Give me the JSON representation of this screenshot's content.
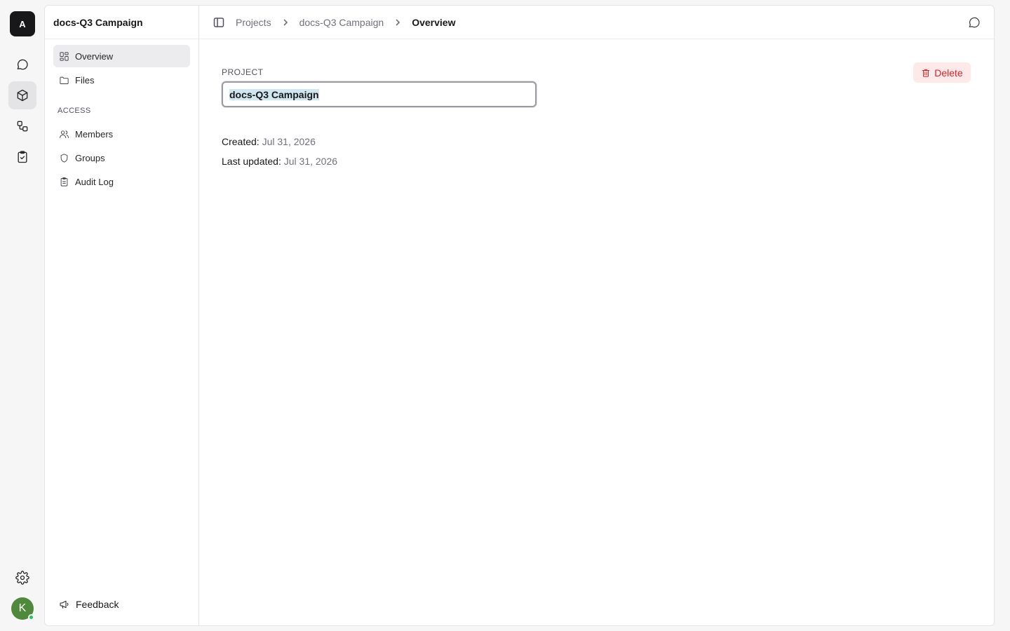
{
  "rail": {
    "logo_letter": "A",
    "avatar_letter": "K",
    "items": [
      {
        "icon": "chat-icon"
      },
      {
        "icon": "box-icon",
        "active": true
      },
      {
        "icon": "workflow-icon"
      },
      {
        "icon": "clipboard-check-icon"
      }
    ],
    "settings_icon": "gear-icon"
  },
  "sidebar": {
    "title": "docs-Q3 Campaign",
    "nav": [
      {
        "label": "Overview",
        "icon": "dashboard-icon",
        "active": true
      },
      {
        "label": "Files",
        "icon": "folder-icon"
      }
    ],
    "access_section_label": "ACCESS",
    "access": [
      {
        "label": "Members",
        "icon": "users-icon"
      },
      {
        "label": "Groups",
        "icon": "shield-icon"
      },
      {
        "label": "Audit Log",
        "icon": "clipboard-list-icon"
      }
    ],
    "feedback_label": "Feedback"
  },
  "topbar": {
    "breadcrumbs": [
      "Projects",
      "docs-Q3 Campaign",
      "Overview"
    ]
  },
  "main": {
    "field_label": "PROJECT",
    "project_name_value": "docs-Q3 Campaign",
    "delete_label": "Delete",
    "created_key": "Created:",
    "created_value": "Jul 31, 2026",
    "updated_key": "Last updated:",
    "updated_value": "Jul 31, 2026"
  },
  "colors": {
    "danger": "#dc2626",
    "danger_bg": "#fde8ea",
    "avatar": "#4f8a3c",
    "online": "#22c55e"
  }
}
